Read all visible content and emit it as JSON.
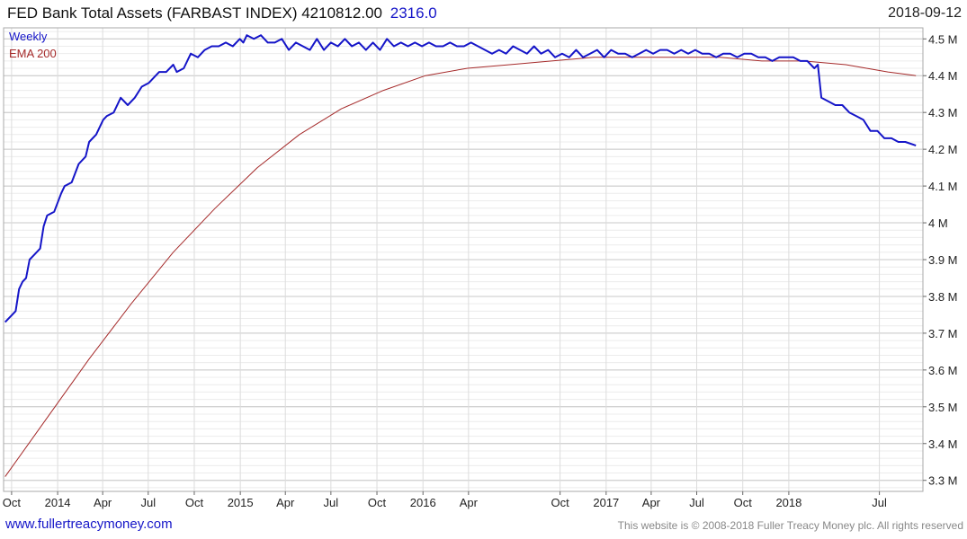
{
  "header": {
    "title": "FED Bank Total Assets (FARBAST INDEX) 4210812.00",
    "change": "2316.0",
    "change_color": "#1515c8",
    "date": "2018-09-12"
  },
  "footer": {
    "url": "www.fullertreacymoney.com",
    "url_color": "#1515c8",
    "copyright": "This website is © 2008-2018 Fuller Treacy Money plc. All rights reserved"
  },
  "chart_data": {
    "type": "line",
    "title": "FED Bank Total Assets (FARBAST INDEX)",
    "x_unit": "date",
    "ylim": [
      3.27,
      4.53
    ],
    "y_unit": "M",
    "grid": true,
    "legend_position": "top-left",
    "x_ticks": [
      {
        "label": "Oct",
        "date": "2013-10-01"
      },
      {
        "label": "2014",
        "date": "2014-01-01"
      },
      {
        "label": "Apr",
        "date": "2014-04-01"
      },
      {
        "label": "Jul",
        "date": "2014-07-01"
      },
      {
        "label": "Oct",
        "date": "2014-10-01"
      },
      {
        "label": "2015",
        "date": "2015-01-01"
      },
      {
        "label": "Apr",
        "date": "2015-04-01"
      },
      {
        "label": "Jul",
        "date": "2015-07-01"
      },
      {
        "label": "Oct",
        "date": "2015-10-01"
      },
      {
        "label": "2016",
        "date": "2016-01-01"
      },
      {
        "label": "Apr",
        "date": "2016-04-01"
      },
      {
        "label": "Oct",
        "date": "2016-10-01"
      },
      {
        "label": "2017",
        "date": "2017-01-01"
      },
      {
        "label": "Apr",
        "date": "2017-04-01"
      },
      {
        "label": "Jul",
        "date": "2017-07-01"
      },
      {
        "label": "Oct",
        "date": "2017-10-01"
      },
      {
        "label": "2018",
        "date": "2018-01-01"
      },
      {
        "label": "Jul",
        "date": "2018-07-01"
      }
    ],
    "y_ticks": [
      {
        "label": "4.5 M",
        "value": 4.5
      },
      {
        "label": "4.4 M",
        "value": 4.4
      },
      {
        "label": "4.3 M",
        "value": 4.3
      },
      {
        "label": "4.2 M",
        "value": 4.2
      },
      {
        "label": "4.1 M",
        "value": 4.1
      },
      {
        "label": "4 M",
        "value": 4.0
      },
      {
        "label": "3.9 M",
        "value": 3.9
      },
      {
        "label": "3.8 M",
        "value": 3.8
      },
      {
        "label": "3.7 M",
        "value": 3.7
      },
      {
        "label": "3.6 M",
        "value": 3.6
      },
      {
        "label": "3.5 M",
        "value": 3.5
      },
      {
        "label": "3.4 M",
        "value": 3.4
      },
      {
        "label": "3.3 M",
        "value": 3.3
      }
    ],
    "series": [
      {
        "name": "Weekly",
        "color": "#1515c8",
        "points": [
          [
            "2013-09-18",
            3.73
          ],
          [
            "2013-10-02",
            3.75
          ],
          [
            "2013-10-09",
            3.76
          ],
          [
            "2013-10-16",
            3.82
          ],
          [
            "2013-10-23",
            3.84
          ],
          [
            "2013-10-30",
            3.85
          ],
          [
            "2013-11-06",
            3.9
          ],
          [
            "2013-11-13",
            3.91
          ],
          [
            "2013-11-27",
            3.93
          ],
          [
            "2013-12-04",
            3.99
          ],
          [
            "2013-12-11",
            4.02
          ],
          [
            "2013-12-25",
            4.03
          ],
          [
            "2014-01-08",
            4.08
          ],
          [
            "2014-01-15",
            4.1
          ],
          [
            "2014-01-29",
            4.11
          ],
          [
            "2014-02-12",
            4.16
          ],
          [
            "2014-02-26",
            4.18
          ],
          [
            "2014-03-05",
            4.22
          ],
          [
            "2014-03-19",
            4.24
          ],
          [
            "2014-04-02",
            4.28
          ],
          [
            "2014-04-09",
            4.29
          ],
          [
            "2014-04-23",
            4.3
          ],
          [
            "2014-05-07",
            4.34
          ],
          [
            "2014-05-21",
            4.32
          ],
          [
            "2014-06-04",
            4.34
          ],
          [
            "2014-06-18",
            4.37
          ],
          [
            "2014-07-02",
            4.38
          ],
          [
            "2014-07-23",
            4.41
          ],
          [
            "2014-08-06",
            4.41
          ],
          [
            "2014-08-20",
            4.43
          ],
          [
            "2014-08-27",
            4.41
          ],
          [
            "2014-09-10",
            4.42
          ],
          [
            "2014-09-24",
            4.46
          ],
          [
            "2014-10-08",
            4.45
          ],
          [
            "2014-10-22",
            4.47
          ],
          [
            "2014-11-05",
            4.48
          ],
          [
            "2014-11-19",
            4.48
          ],
          [
            "2014-12-03",
            4.49
          ],
          [
            "2014-12-17",
            4.48
          ],
          [
            "2014-12-31",
            4.5
          ],
          [
            "2015-01-07",
            4.49
          ],
          [
            "2015-01-14",
            4.51
          ],
          [
            "2015-01-28",
            4.5
          ],
          [
            "2015-02-11",
            4.51
          ],
          [
            "2015-02-25",
            4.49
          ],
          [
            "2015-03-11",
            4.49
          ],
          [
            "2015-03-25",
            4.5
          ],
          [
            "2015-04-08",
            4.47
          ],
          [
            "2015-04-22",
            4.49
          ],
          [
            "2015-05-06",
            4.48
          ],
          [
            "2015-05-20",
            4.47
          ],
          [
            "2015-06-03",
            4.5
          ],
          [
            "2015-06-17",
            4.47
          ],
          [
            "2015-07-01",
            4.49
          ],
          [
            "2015-07-15",
            4.48
          ],
          [
            "2015-07-29",
            4.5
          ],
          [
            "2015-08-12",
            4.48
          ],
          [
            "2015-08-26",
            4.49
          ],
          [
            "2015-09-09",
            4.47
          ],
          [
            "2015-09-23",
            4.49
          ],
          [
            "2015-10-07",
            4.47
          ],
          [
            "2015-10-21",
            4.5
          ],
          [
            "2015-11-04",
            4.48
          ],
          [
            "2015-11-18",
            4.49
          ],
          [
            "2015-12-02",
            4.48
          ],
          [
            "2015-12-16",
            4.49
          ],
          [
            "2015-12-30",
            4.48
          ],
          [
            "2016-01-13",
            4.49
          ],
          [
            "2016-01-27",
            4.48
          ],
          [
            "2016-02-10",
            4.48
          ],
          [
            "2016-02-24",
            4.49
          ],
          [
            "2016-03-09",
            4.48
          ],
          [
            "2016-03-23",
            4.48
          ],
          [
            "2016-04-06",
            4.49
          ],
          [
            "2016-04-20",
            4.48
          ],
          [
            "2016-05-04",
            4.47
          ],
          [
            "2016-05-18",
            4.46
          ],
          [
            "2016-06-01",
            4.47
          ],
          [
            "2016-06-15",
            4.46
          ],
          [
            "2016-06-29",
            4.48
          ],
          [
            "2016-07-13",
            4.47
          ],
          [
            "2016-07-27",
            4.46
          ],
          [
            "2016-08-10",
            4.48
          ],
          [
            "2016-08-24",
            4.46
          ],
          [
            "2016-09-07",
            4.47
          ],
          [
            "2016-09-21",
            4.45
          ],
          [
            "2016-10-05",
            4.46
          ],
          [
            "2016-10-19",
            4.45
          ],
          [
            "2016-11-02",
            4.47
          ],
          [
            "2016-11-16",
            4.45
          ],
          [
            "2016-11-30",
            4.46
          ],
          [
            "2016-12-14",
            4.47
          ],
          [
            "2016-12-28",
            4.45
          ],
          [
            "2017-01-11",
            4.47
          ],
          [
            "2017-01-25",
            4.46
          ],
          [
            "2017-02-08",
            4.46
          ],
          [
            "2017-02-22",
            4.45
          ],
          [
            "2017-03-08",
            4.46
          ],
          [
            "2017-03-22",
            4.47
          ],
          [
            "2017-04-05",
            4.46
          ],
          [
            "2017-04-19",
            4.47
          ],
          [
            "2017-05-03",
            4.47
          ],
          [
            "2017-05-17",
            4.46
          ],
          [
            "2017-05-31",
            4.47
          ],
          [
            "2017-06-14",
            4.46
          ],
          [
            "2017-06-28",
            4.47
          ],
          [
            "2017-07-12",
            4.46
          ],
          [
            "2017-07-26",
            4.46
          ],
          [
            "2017-08-09",
            4.45
          ],
          [
            "2017-08-23",
            4.46
          ],
          [
            "2017-09-06",
            4.46
          ],
          [
            "2017-09-20",
            4.45
          ],
          [
            "2017-10-04",
            4.46
          ],
          [
            "2017-10-18",
            4.46
          ],
          [
            "2017-11-01",
            4.45
          ],
          [
            "2017-11-15",
            4.45
          ],
          [
            "2017-11-29",
            4.44
          ],
          [
            "2017-12-13",
            4.45
          ],
          [
            "2017-12-27",
            4.45
          ],
          [
            "2018-01-10",
            4.45
          ],
          [
            "2018-01-24",
            4.44
          ],
          [
            "2018-02-07",
            4.44
          ],
          [
            "2018-02-21",
            4.42
          ],
          [
            "2018-02-28",
            4.43
          ],
          [
            "2018-03-07",
            4.34
          ],
          [
            "2018-03-21",
            4.33
          ],
          [
            "2018-04-04",
            4.32
          ],
          [
            "2018-04-18",
            4.32
          ],
          [
            "2018-05-02",
            4.3
          ],
          [
            "2018-05-16",
            4.29
          ],
          [
            "2018-05-30",
            4.28
          ],
          [
            "2018-06-13",
            4.25
          ],
          [
            "2018-06-27",
            4.25
          ],
          [
            "2018-07-11",
            4.23
          ],
          [
            "2018-07-25",
            4.23
          ],
          [
            "2018-08-08",
            4.22
          ],
          [
            "2018-08-22",
            4.22
          ],
          [
            "2018-09-12",
            4.21
          ]
        ]
      },
      {
        "name": "EMA 200",
        "color": "#a52a2a",
        "points": [
          [
            "2013-09-18",
            3.31
          ],
          [
            "2013-12-11",
            3.47
          ],
          [
            "2014-03-05",
            3.63
          ],
          [
            "2014-05-28",
            3.78
          ],
          [
            "2014-08-20",
            3.92
          ],
          [
            "2014-11-12",
            4.04
          ],
          [
            "2015-02-04",
            4.15
          ],
          [
            "2015-04-29",
            4.24
          ],
          [
            "2015-07-22",
            4.31
          ],
          [
            "2015-10-14",
            4.36
          ],
          [
            "2016-01-06",
            4.4
          ],
          [
            "2016-03-30",
            4.42
          ],
          [
            "2016-06-22",
            4.43
          ],
          [
            "2016-09-14",
            4.44
          ],
          [
            "2016-12-07",
            4.45
          ],
          [
            "2017-03-01",
            4.45
          ],
          [
            "2017-05-24",
            4.45
          ],
          [
            "2017-08-16",
            4.45
          ],
          [
            "2017-11-08",
            4.44
          ],
          [
            "2018-01-31",
            4.44
          ],
          [
            "2018-04-25",
            4.43
          ],
          [
            "2018-07-18",
            4.41
          ],
          [
            "2018-09-12",
            4.4
          ]
        ]
      }
    ]
  }
}
